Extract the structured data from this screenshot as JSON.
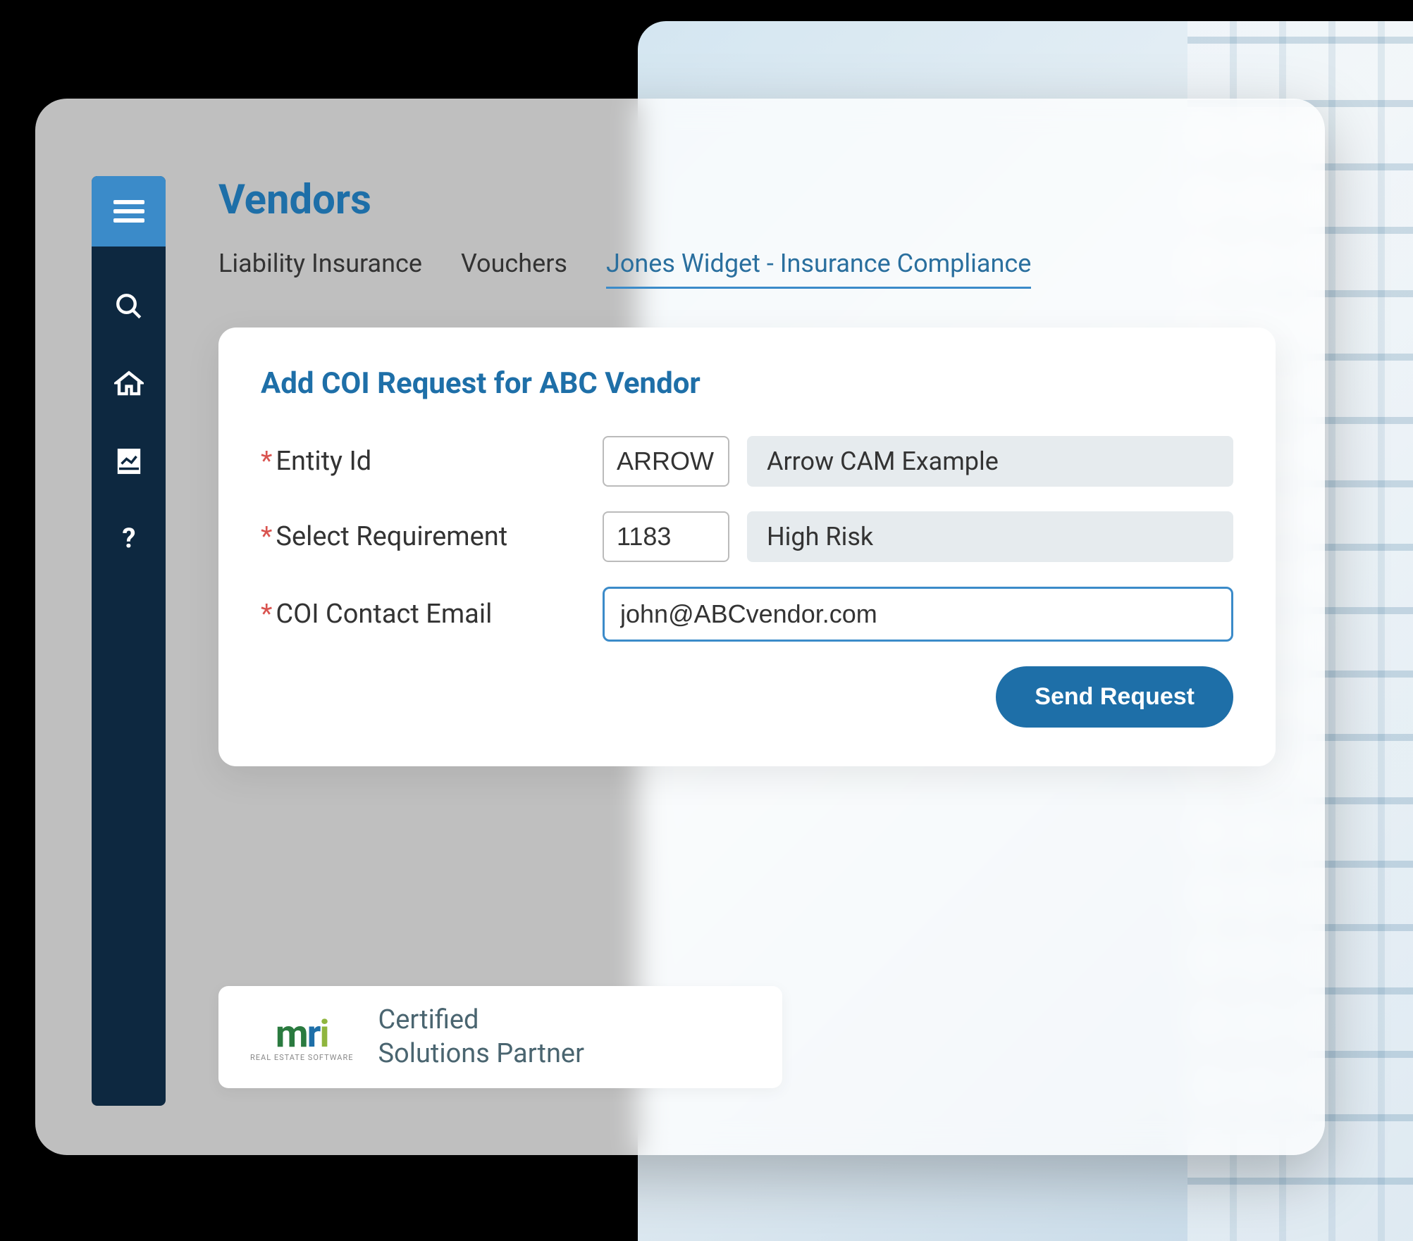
{
  "page_title": "Vendors",
  "tabs": [
    {
      "label": "Liability Insurance",
      "active": false
    },
    {
      "label": "Vouchers",
      "active": false
    },
    {
      "label": "Jones Widget - Insurance Compliance",
      "active": true
    }
  ],
  "card": {
    "title": "Add COI Request for ABC Vendor",
    "fields": {
      "entity_id": {
        "label": "Entity Id",
        "required": true,
        "code": "ARROW",
        "description": "Arrow CAM Example"
      },
      "requirement": {
        "label": "Select Requirement",
        "required": true,
        "code": "1183",
        "description": "High Risk"
      },
      "email": {
        "label": "COI Contact Email",
        "required": true,
        "value": "john@ABCvendor.com"
      }
    },
    "submit_label": "Send Request"
  },
  "partner": {
    "logo_text": "mri",
    "logo_subtitle": "REAL ESTATE SOFTWARE",
    "line1": "Certified",
    "line2": "Solutions Partner"
  },
  "sidebar_icons": [
    "menu",
    "search",
    "home",
    "report",
    "help"
  ],
  "colors": {
    "primary": "#1e6fa8",
    "sidebar_bg": "#0d2840",
    "hamburger_bg": "#3b8bc9"
  }
}
